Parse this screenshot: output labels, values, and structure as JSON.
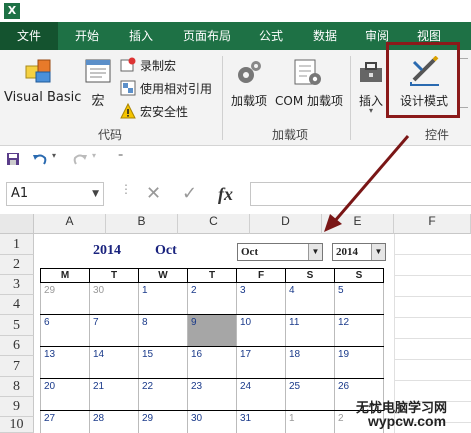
{
  "app": {
    "logo": "X"
  },
  "tabs": [
    "文件",
    "开始",
    "插入",
    "页面布局",
    "公式",
    "数据",
    "审阅",
    "视图"
  ],
  "ribbon": {
    "code": {
      "visual_basic": "Visual Basic",
      "macro": "宏",
      "record_macro": "录制宏",
      "relative_ref": "使用相对引用",
      "macro_security": "宏安全性",
      "label": "代码"
    },
    "addins": {
      "addin": "加载项",
      "com_addin": "COM 加载项",
      "label": "加载项"
    },
    "controls": {
      "insert": "插入",
      "design_mode": "设计模式",
      "label": "控件"
    }
  },
  "formula_bar": {
    "name_box": "A1",
    "fx": "fx",
    "cancel": "✕",
    "enter": "✓"
  },
  "grid": {
    "columns": [
      "A",
      "B",
      "C",
      "D",
      "E",
      "F"
    ],
    "rows": [
      "1",
      "2",
      "3",
      "4",
      "5",
      "6",
      "7",
      "8",
      "9",
      "10"
    ]
  },
  "calendar": {
    "year": "2014",
    "month": "Oct",
    "month_select": "Oct",
    "year_select": "2014",
    "weekdays": [
      "M",
      "T",
      "W",
      "T",
      "F",
      "S",
      "S"
    ],
    "weeks": [
      [
        {
          "d": "29",
          "other": true
        },
        {
          "d": "30",
          "other": true
        },
        {
          "d": "1"
        },
        {
          "d": "2"
        },
        {
          "d": "3"
        },
        {
          "d": "4"
        },
        {
          "d": "5"
        }
      ],
      [
        {
          "d": "6"
        },
        {
          "d": "7"
        },
        {
          "d": "8"
        },
        {
          "d": "9",
          "today": true
        },
        {
          "d": "10"
        },
        {
          "d": "11"
        },
        {
          "d": "12"
        }
      ],
      [
        {
          "d": "13"
        },
        {
          "d": "14"
        },
        {
          "d": "15"
        },
        {
          "d": "16"
        },
        {
          "d": "17"
        },
        {
          "d": "18"
        },
        {
          "d": "19"
        }
      ],
      [
        {
          "d": "20"
        },
        {
          "d": "21"
        },
        {
          "d": "22"
        },
        {
          "d": "23"
        },
        {
          "d": "24"
        },
        {
          "d": "25"
        },
        {
          "d": "26"
        }
      ],
      [
        {
          "d": "27"
        },
        {
          "d": "28"
        },
        {
          "d": "29"
        },
        {
          "d": "30"
        },
        {
          "d": "31"
        },
        {
          "d": "1",
          "other": true
        },
        {
          "d": "2",
          "other": true
        }
      ]
    ]
  },
  "watermark": {
    "line1": "无忧电脑学习网",
    "line2": "wypcw.com"
  },
  "colors": {
    "excel_green": "#1e7145",
    "highlight": "#8b1a1a",
    "calendar_text": "#1a237e"
  }
}
